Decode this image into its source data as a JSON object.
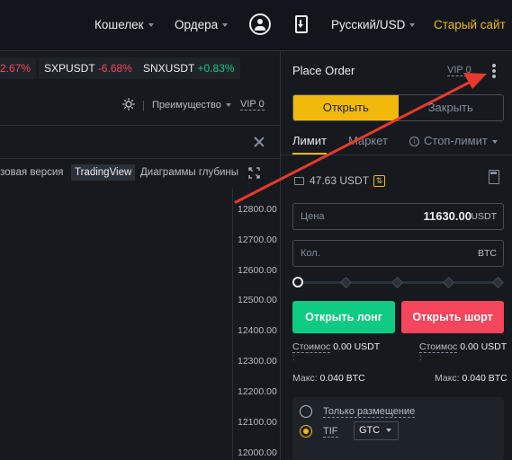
{
  "nav": {
    "wallet": "Кошелек",
    "orders": "Ордера",
    "language_currency": "Русский/USD",
    "old_site": "Старый сайт"
  },
  "tickers": [
    {
      "symbol": "",
      "change": "2.67%",
      "direction": "down"
    },
    {
      "symbol": "SXPUSDT",
      "change": "-6.68%",
      "direction": "down"
    },
    {
      "symbol": "SNXUSDT",
      "change": "+0.83%",
      "direction": "up"
    }
  ],
  "toolbar": {
    "advantage": "Преимущество",
    "vip": "VIP 0"
  },
  "chart_views": {
    "basic": "зовая версия",
    "tradingview": "TradingView",
    "depth": "Диаграммы глубины",
    "active": "TradingView"
  },
  "price_axis": [
    "12800.00",
    "12700.00",
    "12600.00",
    "12500.00",
    "12400.00",
    "12300.00",
    "12200.00",
    "12100.00",
    "12000.00"
  ],
  "order_panel": {
    "title": "Place Order",
    "vip": "VIP 0",
    "open_label": "Открыть",
    "close_label": "Закрыть",
    "order_types": [
      "Лимит",
      "Маркет",
      "Стоп-лимит"
    ],
    "active_type": "Лимит",
    "balance": "47.63 USDT",
    "price_label": "Цена",
    "price_value": "11630.00",
    "price_unit": "USDT",
    "qty_label": "Кол.",
    "qty_unit": "BTC",
    "slider_percent": 0,
    "long_button": "Открыть лонг",
    "short_button": "Открыть шорт",
    "cost_label": "Стоимос",
    "cost_long": "0.00 USDT",
    "cost_short": "0.00 USDT",
    "colon": ":",
    "max_label": "Макс:",
    "max_long": "0.040 BTC",
    "max_short": "0.040 BTC",
    "post_only": "Только размещение",
    "tif_label": "TIF",
    "tif_value": "GTC"
  },
  "colors": {
    "accent": "#f0b90b",
    "buy": "#0ecb81",
    "sell": "#f6465d",
    "annotation_arrow": "#e8392c"
  },
  "icons": [
    "avatar-icon",
    "download-icon",
    "sun-icon",
    "close-icon",
    "expand-icon",
    "kebab-menu-icon",
    "info-icon",
    "wallet-icon",
    "transfer-icon",
    "calculator-icon",
    "caret-down-icon"
  ]
}
